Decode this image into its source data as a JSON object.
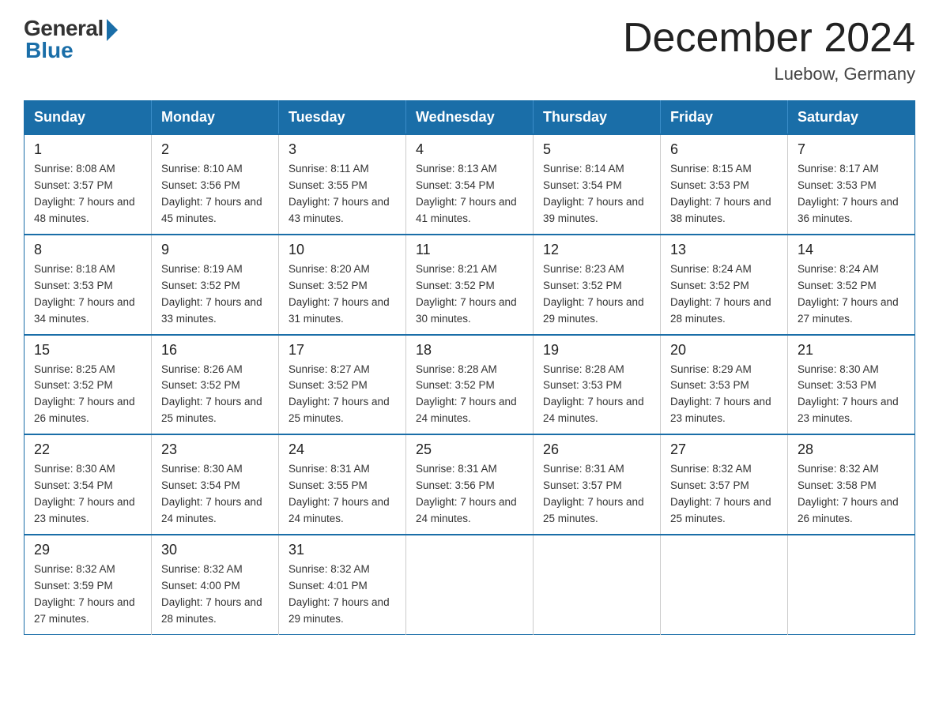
{
  "logo": {
    "general": "General",
    "blue": "Blue"
  },
  "title": "December 2024",
  "location": "Luebow, Germany",
  "days_of_week": [
    "Sunday",
    "Monday",
    "Tuesday",
    "Wednesday",
    "Thursday",
    "Friday",
    "Saturday"
  ],
  "weeks": [
    [
      {
        "day": "1",
        "sunrise": "8:08 AM",
        "sunset": "3:57 PM",
        "daylight": "7 hours and 48 minutes."
      },
      {
        "day": "2",
        "sunrise": "8:10 AM",
        "sunset": "3:56 PM",
        "daylight": "7 hours and 45 minutes."
      },
      {
        "day": "3",
        "sunrise": "8:11 AM",
        "sunset": "3:55 PM",
        "daylight": "7 hours and 43 minutes."
      },
      {
        "day": "4",
        "sunrise": "8:13 AM",
        "sunset": "3:54 PM",
        "daylight": "7 hours and 41 minutes."
      },
      {
        "day": "5",
        "sunrise": "8:14 AM",
        "sunset": "3:54 PM",
        "daylight": "7 hours and 39 minutes."
      },
      {
        "day": "6",
        "sunrise": "8:15 AM",
        "sunset": "3:53 PM",
        "daylight": "7 hours and 38 minutes."
      },
      {
        "day": "7",
        "sunrise": "8:17 AM",
        "sunset": "3:53 PM",
        "daylight": "7 hours and 36 minutes."
      }
    ],
    [
      {
        "day": "8",
        "sunrise": "8:18 AM",
        "sunset": "3:53 PM",
        "daylight": "7 hours and 34 minutes."
      },
      {
        "day": "9",
        "sunrise": "8:19 AM",
        "sunset": "3:52 PM",
        "daylight": "7 hours and 33 minutes."
      },
      {
        "day": "10",
        "sunrise": "8:20 AM",
        "sunset": "3:52 PM",
        "daylight": "7 hours and 31 minutes."
      },
      {
        "day": "11",
        "sunrise": "8:21 AM",
        "sunset": "3:52 PM",
        "daylight": "7 hours and 30 minutes."
      },
      {
        "day": "12",
        "sunrise": "8:23 AM",
        "sunset": "3:52 PM",
        "daylight": "7 hours and 29 minutes."
      },
      {
        "day": "13",
        "sunrise": "8:24 AM",
        "sunset": "3:52 PM",
        "daylight": "7 hours and 28 minutes."
      },
      {
        "day": "14",
        "sunrise": "8:24 AM",
        "sunset": "3:52 PM",
        "daylight": "7 hours and 27 minutes."
      }
    ],
    [
      {
        "day": "15",
        "sunrise": "8:25 AM",
        "sunset": "3:52 PM",
        "daylight": "7 hours and 26 minutes."
      },
      {
        "day": "16",
        "sunrise": "8:26 AM",
        "sunset": "3:52 PM",
        "daylight": "7 hours and 25 minutes."
      },
      {
        "day": "17",
        "sunrise": "8:27 AM",
        "sunset": "3:52 PM",
        "daylight": "7 hours and 25 minutes."
      },
      {
        "day": "18",
        "sunrise": "8:28 AM",
        "sunset": "3:52 PM",
        "daylight": "7 hours and 24 minutes."
      },
      {
        "day": "19",
        "sunrise": "8:28 AM",
        "sunset": "3:53 PM",
        "daylight": "7 hours and 24 minutes."
      },
      {
        "day": "20",
        "sunrise": "8:29 AM",
        "sunset": "3:53 PM",
        "daylight": "7 hours and 23 minutes."
      },
      {
        "day": "21",
        "sunrise": "8:30 AM",
        "sunset": "3:53 PM",
        "daylight": "7 hours and 23 minutes."
      }
    ],
    [
      {
        "day": "22",
        "sunrise": "8:30 AM",
        "sunset": "3:54 PM",
        "daylight": "7 hours and 23 minutes."
      },
      {
        "day": "23",
        "sunrise": "8:30 AM",
        "sunset": "3:54 PM",
        "daylight": "7 hours and 24 minutes."
      },
      {
        "day": "24",
        "sunrise": "8:31 AM",
        "sunset": "3:55 PM",
        "daylight": "7 hours and 24 minutes."
      },
      {
        "day": "25",
        "sunrise": "8:31 AM",
        "sunset": "3:56 PM",
        "daylight": "7 hours and 24 minutes."
      },
      {
        "day": "26",
        "sunrise": "8:31 AM",
        "sunset": "3:57 PM",
        "daylight": "7 hours and 25 minutes."
      },
      {
        "day": "27",
        "sunrise": "8:32 AM",
        "sunset": "3:57 PM",
        "daylight": "7 hours and 25 minutes."
      },
      {
        "day": "28",
        "sunrise": "8:32 AM",
        "sunset": "3:58 PM",
        "daylight": "7 hours and 26 minutes."
      }
    ],
    [
      {
        "day": "29",
        "sunrise": "8:32 AM",
        "sunset": "3:59 PM",
        "daylight": "7 hours and 27 minutes."
      },
      {
        "day": "30",
        "sunrise": "8:32 AM",
        "sunset": "4:00 PM",
        "daylight": "7 hours and 28 minutes."
      },
      {
        "day": "31",
        "sunrise": "8:32 AM",
        "sunset": "4:01 PM",
        "daylight": "7 hours and 29 minutes."
      },
      null,
      null,
      null,
      null
    ]
  ]
}
